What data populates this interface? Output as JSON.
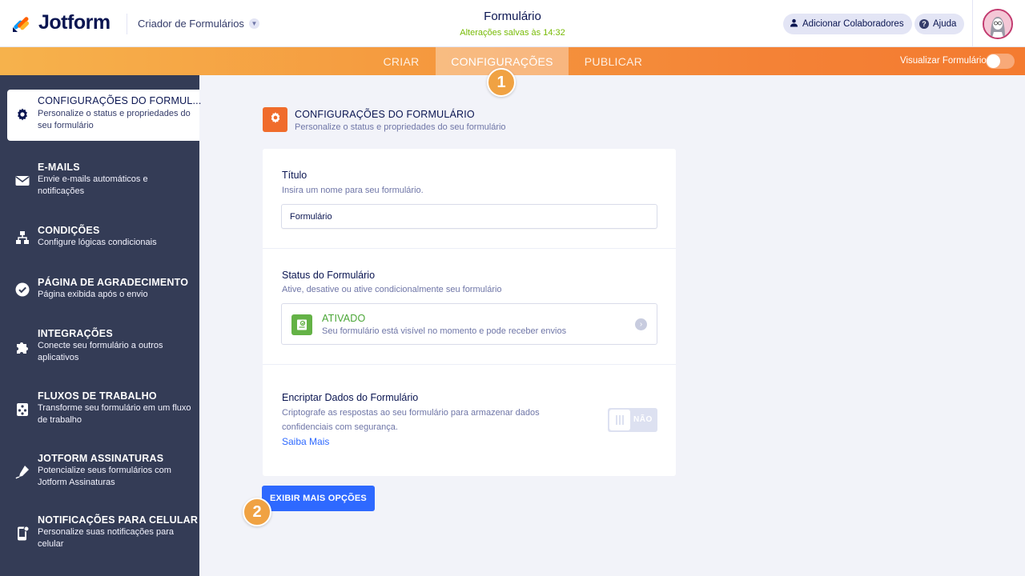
{
  "header": {
    "logo_text": "Jotform",
    "builder_menu": "Criador de Formulários",
    "form_title": "Formulário",
    "saved_status": "Alterações salvas às 14:32",
    "collaborators_label": "Adicionar Colaboradores",
    "help_label": "Ajuda"
  },
  "tabs": {
    "create": "CRIAR",
    "settings": "CONFIGURAÇÕES",
    "publish": "PUBLICAR",
    "active": "settings",
    "preview_label": "Visualizar Formulário",
    "preview_on": false
  },
  "badges": {
    "one": "1",
    "two": "2"
  },
  "sidebar": {
    "items": [
      {
        "title": "CONFIGURAÇÕES DO FORMUL...",
        "desc": "Personalize o status e propriedades do seu formulário",
        "icon": "gear-icon"
      },
      {
        "title": "E-MAILS",
        "desc": "Envie e-mails automáticos e notificações",
        "icon": "envelope-icon"
      },
      {
        "title": "CONDIÇÕES",
        "desc": "Configure lógicas condicionais",
        "icon": "hierarchy-icon"
      },
      {
        "title": "PÁGINA DE AGRADECIMENTO",
        "desc": "Página exibida após o envio",
        "icon": "check-circle-icon"
      },
      {
        "title": "INTEGRAÇÕES",
        "desc": "Conecte seu formulário a outros aplicativos",
        "icon": "puzzle-icon"
      },
      {
        "title": "FLUXOS DE TRABALHO",
        "desc": "Transforme seu formulário em um fluxo de trabalho",
        "icon": "workflow-icon"
      },
      {
        "title": "JOTFORM ASSINATURAS",
        "desc": "Potencialize seus formulários com Jotform Assinaturas",
        "icon": "pen-icon"
      },
      {
        "title": "NOTIFICAÇÕES PARA CELULAR",
        "desc": "Personalize suas notificações para celular",
        "icon": "mobile-icon"
      }
    ]
  },
  "main": {
    "section_title": "CONFIGURAÇÕES DO FORMULÁRIO",
    "section_sub": "Personalize o status e propriedades do seu formulário",
    "title_field": {
      "label": "Título",
      "desc": "Insira um nome para seu formulário.",
      "value": "Formulário"
    },
    "status_field": {
      "label": "Status do Formulário",
      "desc": "Ative, desative ou ative condicionalmente seu formulário",
      "status": "ATIVADO",
      "status_desc": "Seu formulário está visível no momento e pode receber envios"
    },
    "encrypt_field": {
      "label": "Encriptar Dados do Formulário",
      "desc_line1": "Criptografe as respostas ao seu formulário para armazenar dados",
      "desc_line2": "confidenciais com segurança.",
      "link": "Saiba Mais",
      "toggle_text": "NÃO"
    },
    "more_button": "EXIBIR MAIS OPÇÕES"
  },
  "colors": {
    "accent_orange": "#f06c2b",
    "sidebar_bg": "#343c56",
    "primary_blue": "#2e69ff",
    "status_green": "#64b246"
  }
}
